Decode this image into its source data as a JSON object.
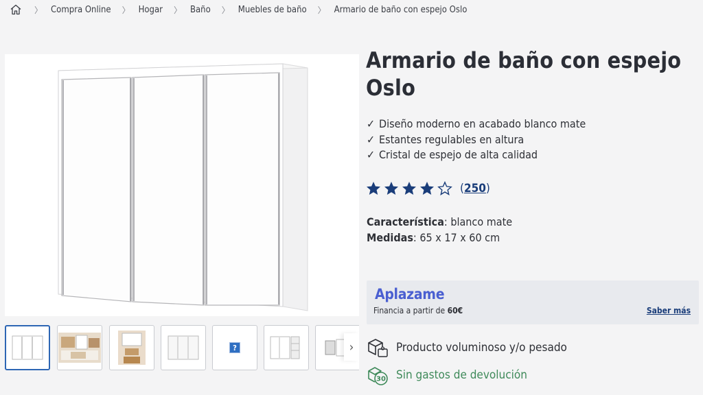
{
  "breadcrumb": {
    "home_icon": "home-icon",
    "items": [
      "Compra Online",
      "Hogar",
      "Baño",
      "Muebles de baño",
      "Armario de baño con espejo Oslo"
    ]
  },
  "product": {
    "title": "Armario de baño con espejo Oslo",
    "features": [
      "Diseño moderno en acabado blanco mate",
      "Estantes regulables en altura",
      "Cristal de espejo de alta calidad"
    ],
    "check_glyph": "✓",
    "rating": {
      "stars": 4,
      "max": 5,
      "count": "250",
      "count_open": "(",
      "count_close": ")"
    },
    "specs": {
      "caracteristica_label": "Característica",
      "caracteristica_value": ": blanco mate",
      "medidas_label": "Medidas",
      "medidas_value": ": 65 x 17 x 60 cm"
    }
  },
  "gallery": {
    "thumbnails": [
      "front-view",
      "bathroom-scene-1",
      "bathroom-scene-2",
      "mirror-doors",
      "placeholder-image",
      "open-side-view",
      "open-view"
    ],
    "active_index": 0,
    "next_glyph": "›",
    "placeholder_glyph": "?"
  },
  "financing": {
    "brand": "Aplazame",
    "text": "Financia a partir de ",
    "amount": "60€",
    "link": "Saber más"
  },
  "shipping": {
    "bulky_text": "Producto voluminoso y/o pesado",
    "returns_text": "Sin gastos de devolución",
    "returns_days": "30"
  },
  "colors": {
    "star": "#1a3d7a",
    "link": "#1a3d7a",
    "aplazame": "#4a5fd1",
    "green": "#3f8a5a",
    "active_thumb": "#2d66b4"
  }
}
